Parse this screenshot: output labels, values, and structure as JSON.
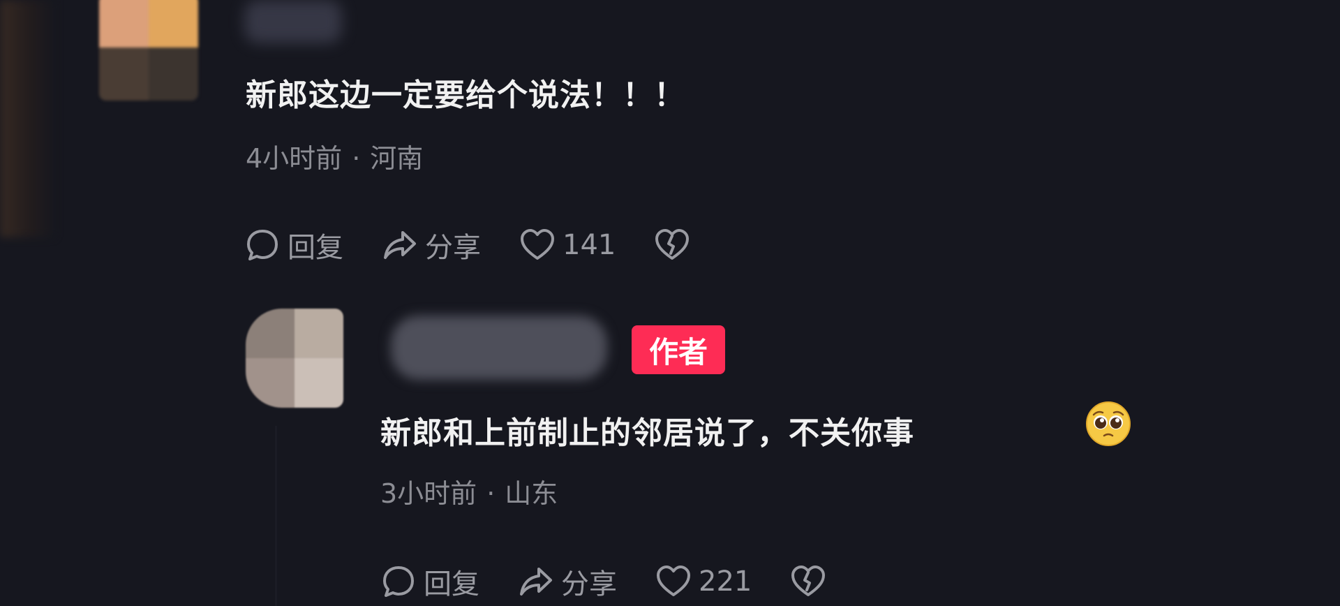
{
  "comments": [
    {
      "text": "新郎这边一定要给个说法！！！",
      "time": "4小时前",
      "location": "河南",
      "actions": {
        "reply_label": "回复",
        "share_label": "分享",
        "like_count": "141"
      }
    },
    {
      "badge": "作者",
      "text": "新郎和上前制止的邻居说了，不关你事",
      "time": "3小时前",
      "location": "山东",
      "actions": {
        "reply_label": "回复",
        "share_label": "分享",
        "like_count": "221"
      }
    }
  ],
  "separator": "·",
  "icons": [
    "comment-icon",
    "share-icon",
    "heart-icon",
    "broken-heart-icon",
    "pleading-face-emoji-icon"
  ],
  "colors": {
    "background": "#16171f",
    "author_badge": "#fe2c55",
    "meta_text": "#8c8d94",
    "action_text": "#9a9ba2"
  }
}
